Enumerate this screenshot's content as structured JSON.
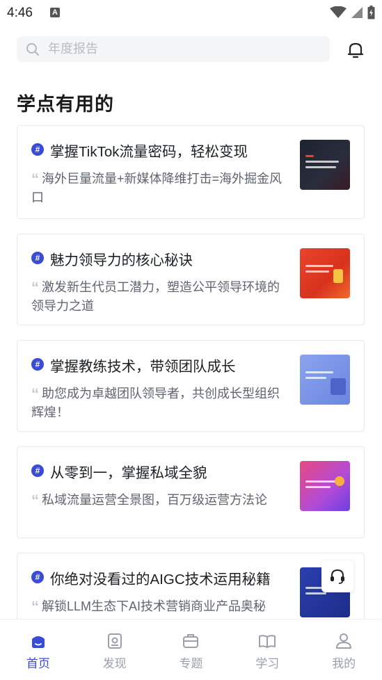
{
  "status_bar": {
    "time": "4:46",
    "notification_badge": "A"
  },
  "search": {
    "placeholder": "年度报告"
  },
  "section_title": "学点有用的",
  "colors": {
    "accent": "#3a4bd6",
    "text_secondary": "#5f6470",
    "tab_inactive": "#9aa0aa"
  },
  "cards": [
    {
      "title": "掌握TikTok流量密码，轻松变现",
      "desc": "海外巨量流量+新媒体降维打击=海外掘金风口"
    },
    {
      "title": "魅力领导力的核心秘诀",
      "desc": "激发新生代员工潜力，塑造公平领导环境的领导力之道"
    },
    {
      "title": "掌握教练技术，带领团队成长",
      "desc": "助您成为卓越团队领导者，共创成长型组织辉煌！"
    },
    {
      "title": "从零到一，掌握私域全貌",
      "desc": "私域流量运营全景图，百万级运营方法论"
    },
    {
      "title": "你绝对没看过的AIGC技术运用秘籍",
      "desc": "解锁LLM生态下AI技术营销商业产品奥秘"
    }
  ],
  "tabs": [
    {
      "label": "首页",
      "icon": "home-icon",
      "active": true
    },
    {
      "label": "发现",
      "icon": "discover-icon",
      "active": false
    },
    {
      "label": "专题",
      "icon": "topic-icon",
      "active": false
    },
    {
      "label": "学习",
      "icon": "book-icon",
      "active": false
    },
    {
      "label": "我的",
      "icon": "user-icon",
      "active": false
    }
  ]
}
